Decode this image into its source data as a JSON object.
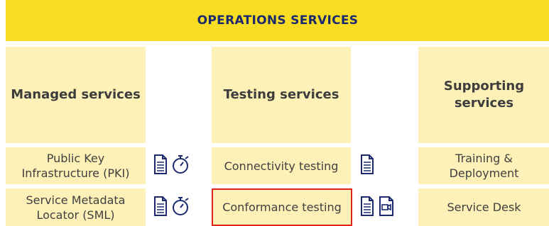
{
  "banner": "OPERATIONS SERVICES",
  "columns": {
    "managed": {
      "header": "Managed services",
      "items": [
        "Public Key\nInfrastructure (PKI)",
        "Service Metadata\nLocator (SML)"
      ]
    },
    "testing": {
      "header": "Testing services",
      "items": [
        "Connectivity testing",
        "Conformance testing"
      ]
    },
    "supporting": {
      "header": "Supporting\nservices",
      "items": [
        "Training &\nDeployment",
        "Service Desk"
      ]
    }
  },
  "icons": {
    "row1_managed": [
      "document-icon",
      "stopwatch-icon"
    ],
    "row2_managed": [
      "document-icon",
      "stopwatch-icon"
    ],
    "row1_testing": [
      "document-icon"
    ],
    "row2_testing": [
      "document-icon",
      "video-icon"
    ]
  },
  "colors": {
    "banner": "#f9dd23",
    "cell": "#fdf1b8",
    "icon": "#1b2a6e",
    "highlight": "#e2231a"
  }
}
